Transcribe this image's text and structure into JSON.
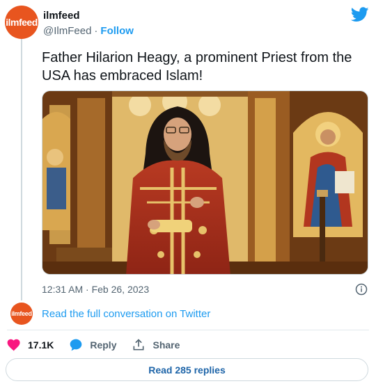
{
  "account": {
    "logo_text": "ilmfeed",
    "display_name": "ilmfeed",
    "handle": "@IlmFeed",
    "separator": "·",
    "follow_label": "Follow"
  },
  "tweet": {
    "text": "Father Hilarion Heagy, a prominent Priest from the USA has embraced Islam!",
    "timestamp": "12:31 AM · Feb 26, 2023"
  },
  "conversation": {
    "logo_text": "ilmfeed",
    "link_label": "Read the full conversation on Twitter"
  },
  "actions": {
    "like_count": "17.1K",
    "reply_label": "Reply",
    "share_label": "Share"
  },
  "read_replies_label": "Read 285 replies",
  "colors": {
    "brand_orange": "#e8551f",
    "twitter_blue": "#1d9bf0",
    "like_pink": "#f91880",
    "reply_blue": "#1d9bf0"
  },
  "icons": [
    "twitter-bird-icon",
    "info-icon",
    "heart-icon",
    "reply-bubble-icon",
    "share-icon"
  ]
}
